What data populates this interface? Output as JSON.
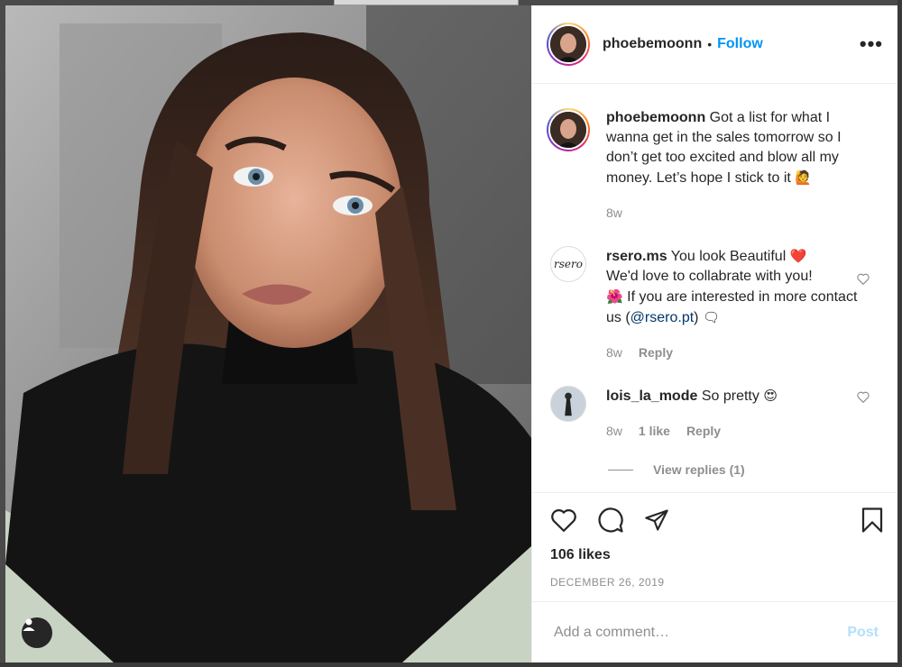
{
  "post": {
    "username": "phoebemoonn",
    "separator": "•",
    "follow_label": "Follow",
    "more_label": "•••",
    "caption": "Got a list for what I wanna get in the sales tomorrow so I don’t get too excited and blow all my money. Let’s hope I stick to it",
    "caption_emoji": "🙋",
    "caption_time": "8w"
  },
  "comments": [
    {
      "username": "rsero.ms",
      "avatar_text": "rsero",
      "text_part1": "You look Beautiful",
      "emoji1": "❤️",
      "text_part2": "We'd love to collabrate with you!",
      "emoji2": "🌺",
      "text_part3": "If you are interested in more contact us (",
      "mention": "@rsero.pt",
      "text_part4": ")",
      "emoji3": "🗨",
      "time": "8w",
      "reply_label": "Reply"
    },
    {
      "username": "lois_la_mode",
      "text": "So pretty",
      "emoji": "😍",
      "time": "8w",
      "likes_label": "1 like",
      "reply_label": "Reply",
      "view_replies": "View replies (1)"
    }
  ],
  "actions": {
    "likes": "106 likes",
    "date": "DECEMBER 26, 2019"
  },
  "add_comment": {
    "placeholder": "Add a comment…",
    "post_label": "Post"
  },
  "colors": {
    "accent": "#0095f6",
    "post_disabled": "#b2dffc",
    "muted": "#8e8e8e",
    "text": "#262626"
  },
  "icons": [
    "user-tag-icon",
    "more-options-icon",
    "heart-icon",
    "comment-icon",
    "share-icon",
    "bookmark-icon"
  ]
}
